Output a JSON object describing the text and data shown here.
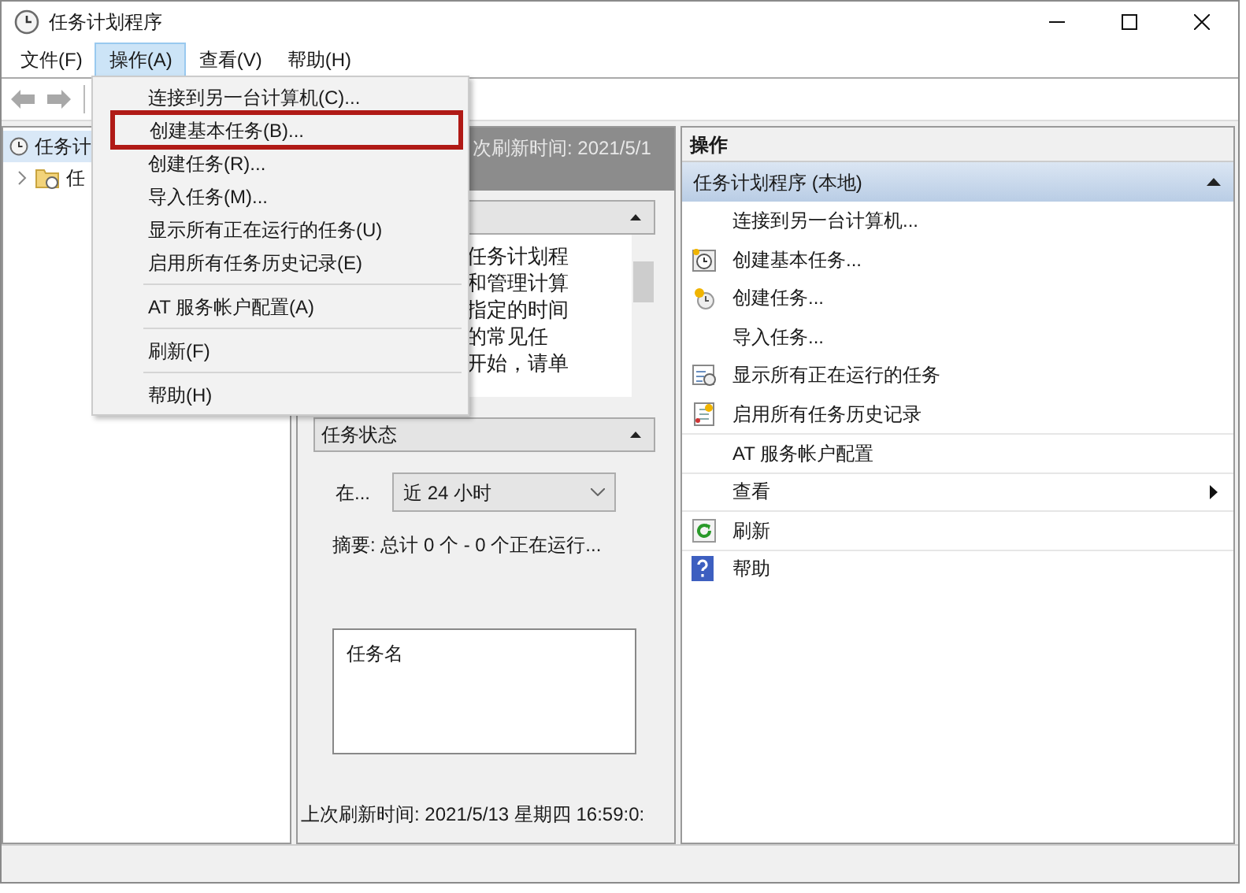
{
  "window": {
    "title": "任务计划程序"
  },
  "menu_bar": [
    {
      "label": "文件(F)",
      "selected": false
    },
    {
      "label": "操作(A)",
      "selected": true
    },
    {
      "label": "查看(V)",
      "selected": false
    },
    {
      "label": "帮助(H)",
      "selected": false
    }
  ],
  "dropdown": [
    {
      "kind": "item",
      "label": "连接到另一台计算机(C)...",
      "annotated": false
    },
    {
      "kind": "item",
      "label": "创建基本任务(B)...",
      "annotated": true
    },
    {
      "kind": "item",
      "label": "创建任务(R)...",
      "annotated": false
    },
    {
      "kind": "item",
      "label": "导入任务(M)...",
      "annotated": false
    },
    {
      "kind": "item",
      "label": "显示所有正在运行的任务(U)",
      "annotated": false
    },
    {
      "kind": "item",
      "label": "启用所有任务历史记录(E)",
      "annotated": false
    },
    {
      "kind": "separator"
    },
    {
      "kind": "item",
      "label": "AT 服务帐户配置(A)",
      "annotated": false
    },
    {
      "kind": "separator"
    },
    {
      "kind": "item",
      "label": "刷新(F)",
      "annotated": false
    },
    {
      "kind": "separator"
    },
    {
      "kind": "item",
      "label": "帮助(H)",
      "annotated": false
    }
  ],
  "tree": [
    {
      "label": "任务计",
      "selected": true,
      "children": [
        {
          "label": "任",
          "expanded": false
        }
      ]
    }
  ],
  "middle": {
    "header": "次刷新时间: 2021/5/1",
    "overview_lines": [
      "任务计划程",
      "和管理计算",
      "指定的时间",
      "的常见任",
      "开始，请单"
    ],
    "status_section": {
      "title": "任务状态",
      "period_label": "在...",
      "period_value": "近 24 小时",
      "summary": "摘要: 总计 0 个 - 0 个正在运行...",
      "list_column": "任务名"
    },
    "footer": "上次刷新时间: 2021/5/13 星期四 16:59:0:"
  },
  "actions": {
    "title": "操作",
    "section": "任务计划程序 (本地)",
    "items": [
      {
        "label": "连接到另一台计算机...",
        "kind": "plain",
        "submenu": false
      },
      {
        "label": "创建基本任务...",
        "kind": "basic",
        "submenu": false
      },
      {
        "label": "创建任务...",
        "kind": "task",
        "submenu": false
      },
      {
        "label": "导入任务...",
        "kind": "plain",
        "submenu": false
      },
      {
        "label": "显示所有正在运行的任务",
        "kind": "running",
        "submenu": false
      },
      {
        "label": "启用所有任务历史记录",
        "kind": "history",
        "submenu": false
      },
      {
        "label": "AT 服务帐户配置",
        "kind": "plain",
        "submenu": false
      },
      {
        "label": "查看",
        "kind": "plain",
        "submenu": true
      },
      {
        "label": "刷新",
        "kind": "refresh",
        "submenu": false
      },
      {
        "label": "帮助",
        "kind": "help",
        "submenu": false
      }
    ]
  }
}
